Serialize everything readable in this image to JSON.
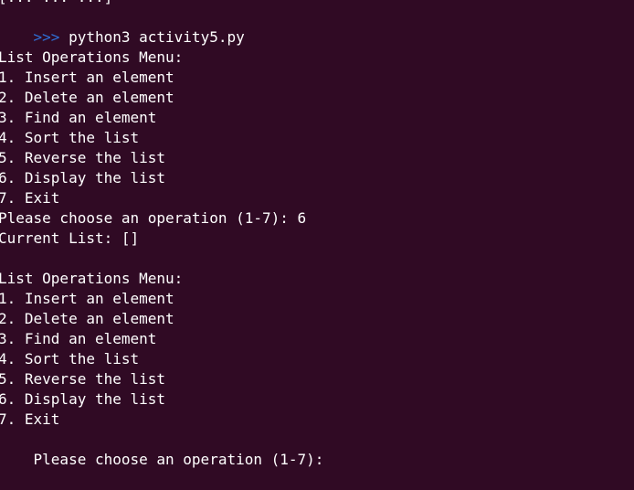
{
  "terminal": {
    "background": "#300a24",
    "foreground": "#ffffff",
    "prompt_color": "#2f6fd6",
    "previous_prompt": "[... ... ...]",
    "prompt": ">>>",
    "command": " python3 activity5.py",
    "blank": "",
    "menu1": {
      "title": "List Operations Menu:",
      "items": [
        "1. Insert an element",
        "2. Delete an element",
        "3. Find an element",
        "4. Sort the list",
        "5. Reverse the list",
        "6. Display the list",
        "7. Exit"
      ],
      "choice": "Please choose an operation (1-7): 6",
      "result": "Current List: []"
    },
    "menu2": {
      "title": "List Operations Menu:",
      "items": [
        "1. Insert an element",
        "2. Delete an element",
        "3. Find an element",
        "4. Sort the list",
        "5. Reverse the list",
        "6. Display the list",
        "7. Exit"
      ],
      "choice": "Please choose an operation (1-7): "
    }
  }
}
